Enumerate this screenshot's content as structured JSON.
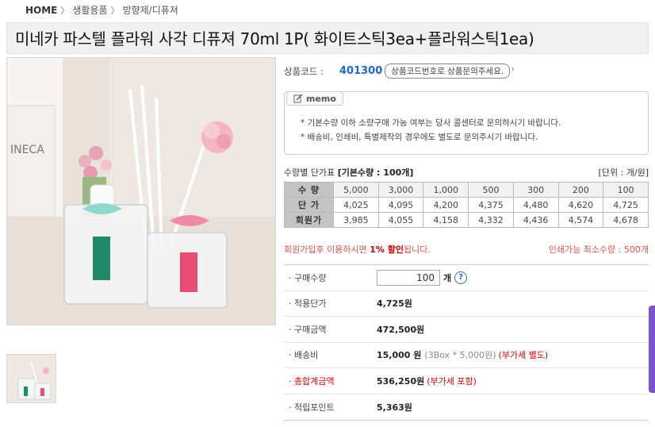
{
  "breadcrumb": {
    "home": "HOME",
    "level1": "생활용품",
    "level2": "방향제/디퓨져",
    "separator": "〉"
  },
  "product": {
    "title": "미네카 파스텔 플라워 사각 디퓨져 70ml 1P( 화이트스틱3ea+플라워스틱1ea)",
    "code_label": "상품코드 :",
    "code": "401300",
    "code_note": "상품코드번호로 상품문의주세요.",
    "code_tick": "'"
  },
  "memo": {
    "tag": "memo",
    "lines": [
      "* 기본수량 이하 소량구매 가능 여부는 당사 콜센터로 문의하시기 바랍니다.",
      "* 배송비, 인쇄비, 특별제작의 경우에도 별도로 문의주시기 바랍니다."
    ]
  },
  "qty_table": {
    "caption": "수량별 단가표",
    "base_qty": "[기본수량 : 100개]",
    "unit": "[단위 : 개/원]",
    "row_labels": [
      "수 량",
      "단 가",
      "회원가"
    ],
    "quantities": [
      "5,000",
      "3,000",
      "1,000",
      "500",
      "300",
      "200",
      "100"
    ],
    "prices": [
      "4,025",
      "4,095",
      "4,200",
      "4,375",
      "4,480",
      "4,620",
      "4,725"
    ],
    "member_prices": [
      "3,985",
      "4,055",
      "4,158",
      "4,332",
      "4,436",
      "4,574",
      "4,678"
    ]
  },
  "notice": {
    "member_pre": "회원가입후 이용하시면 ",
    "member_discount": "1% 할인",
    "member_post": "됩니다.",
    "min_print": "인쇄가능 최소수량 : 500개"
  },
  "purchase": {
    "qty_label": "· 구매수량",
    "qty_value": "100",
    "qty_unit": "개",
    "help": "?",
    "unit_price_label": "· 적용단가",
    "unit_price": "4,725원",
    "amount_label": "· 구매금액",
    "amount": "472,500원",
    "shipping_label": "· 배송비",
    "shipping": "15,000 원",
    "shipping_detail": "(3Box * 5,000원)",
    "shipping_vat": "(부가세 별도)",
    "total_label": "· 총합계금액",
    "total": "536,250원",
    "total_vat": "(부가세 포함)",
    "points_label": "· 적립포인트",
    "points": "5,363원"
  },
  "colors": {
    "code_blue": "#2266cc",
    "alert_red": "#d00000",
    "table_header": "#c4c4c4"
  }
}
